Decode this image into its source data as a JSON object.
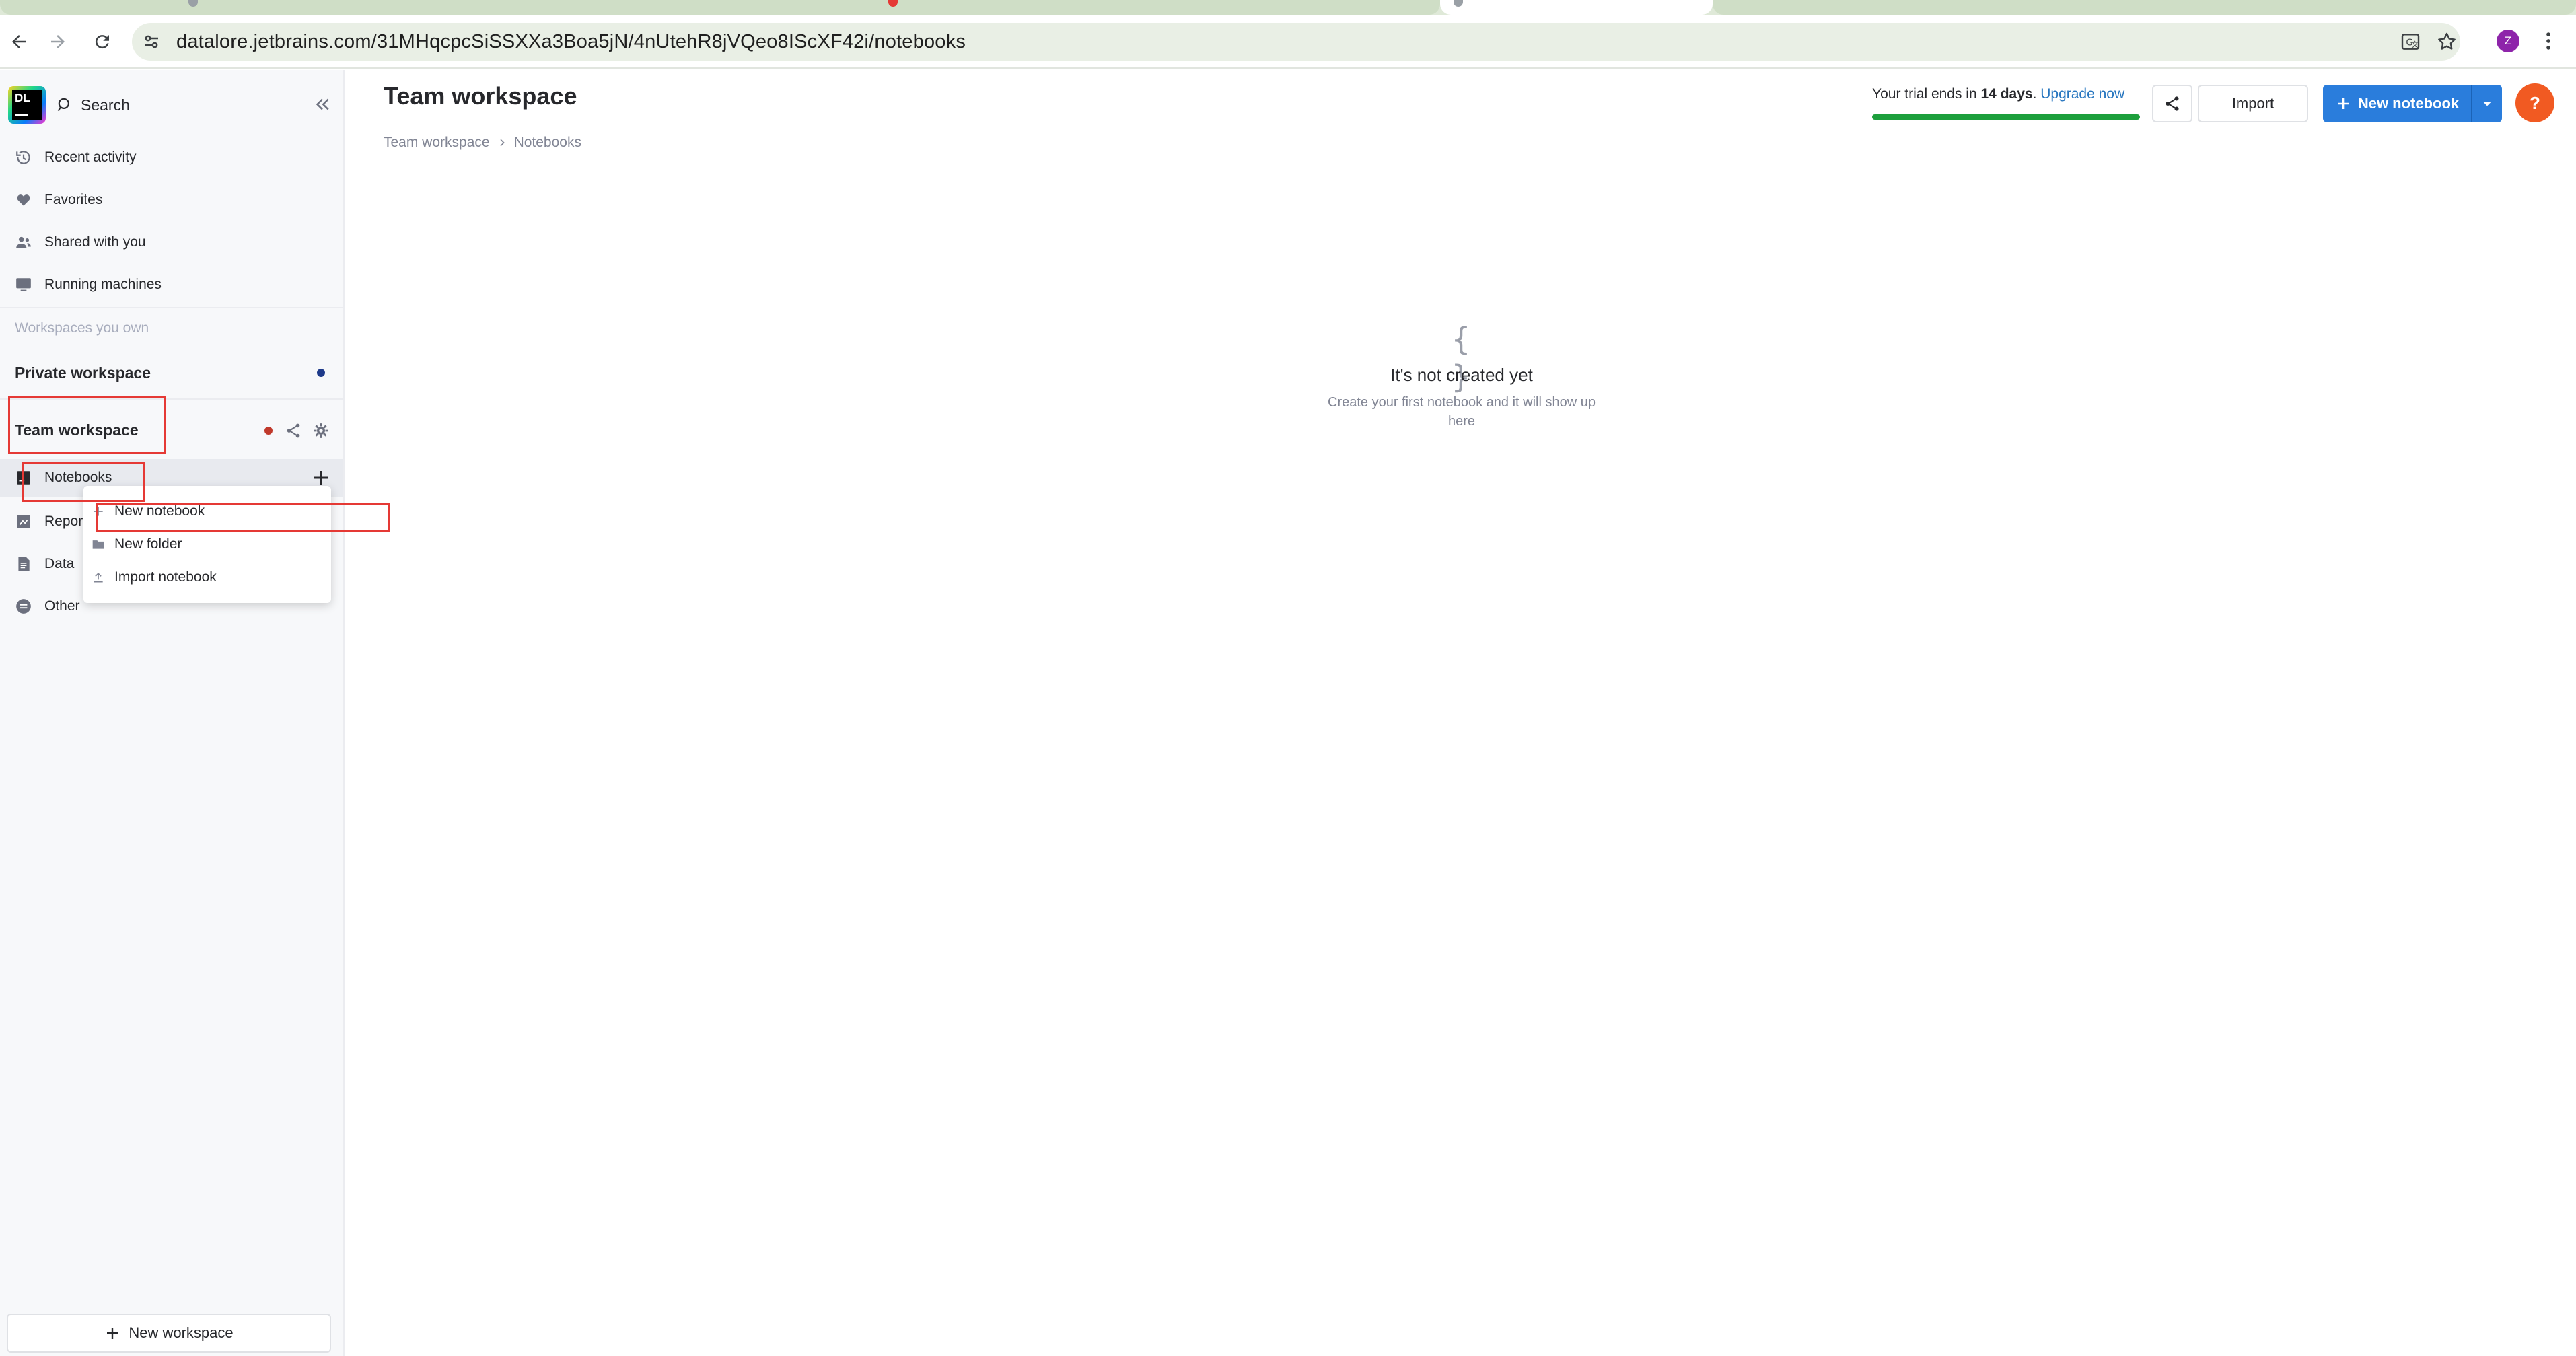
{
  "browser": {
    "url": "datalore.jetbrains.com/31MHqcpcSiSSXXa3Boa5jN/4nUtehR8jVQeo8IScXF42i/notebooks",
    "profile_initial": "Z"
  },
  "sidebar": {
    "logo_text": "DL",
    "search_label": "Search",
    "nav_items": [
      {
        "label": "Recent activity",
        "icon": "history-icon"
      },
      {
        "label": "Favorites",
        "icon": "heart-icon"
      },
      {
        "label": "Shared with you",
        "icon": "people-icon"
      },
      {
        "label": "Running machines",
        "icon": "monitor-icon"
      }
    ],
    "section_label": "Workspaces you own",
    "private_workspace": "Private workspace",
    "team_workspace": "Team workspace",
    "team_items": [
      {
        "label": "Notebooks",
        "icon": "notebook-icon"
      },
      {
        "label": "Reports",
        "visible_label": "Repor",
        "icon": "report-icon"
      },
      {
        "label": "Data",
        "icon": "file-icon"
      },
      {
        "label": "Other",
        "icon": "other-icon"
      }
    ],
    "new_workspace_label": "New workspace"
  },
  "context_menu": {
    "items": [
      {
        "label": "New notebook",
        "icon": "plus-icon"
      },
      {
        "label": "New folder",
        "icon": "folder-icon"
      },
      {
        "label": "Import notebook",
        "icon": "upload-icon"
      }
    ]
  },
  "main": {
    "title": "Team workspace",
    "breadcrumb": [
      "Team workspace",
      "Notebooks"
    ],
    "trial": {
      "prefix": "Your trial ends in ",
      "days": "14 days",
      "suffix": ". ",
      "upgrade": "Upgrade now",
      "progress_fraction": 1.0
    },
    "import_label": "Import",
    "new_notebook_label": "New notebook",
    "help_label": "?",
    "empty_state": {
      "icon": "{ }",
      "title": "It's not created yet",
      "description": "Create your first notebook and it will show up here"
    }
  },
  "colors": {
    "accent": "#2a7ddc",
    "trial_progress": "#1d9f3c",
    "help": "#f15a22",
    "private_dot": "#1e3a8a",
    "team_dot": "#c0392b",
    "annotation": "#e53935"
  }
}
